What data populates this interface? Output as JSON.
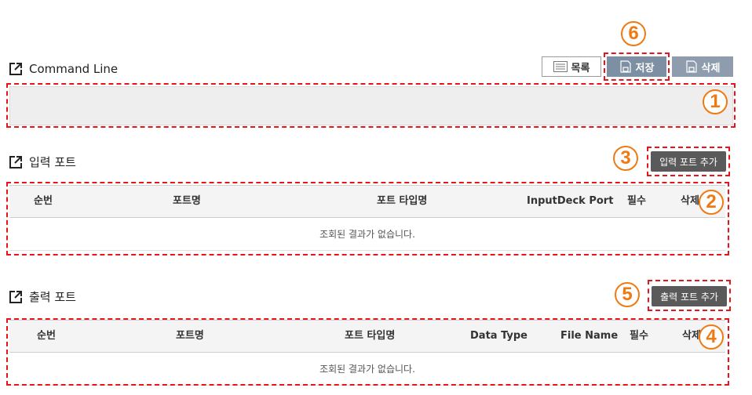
{
  "toolbar": {
    "list_label": "목록",
    "save_label": "저장",
    "delete_label": "삭제"
  },
  "command_line": {
    "title": "Command Line",
    "value": ""
  },
  "input_ports": {
    "title": "입력 포트",
    "add_button": "입력 포트 추가",
    "columns": [
      "순번",
      "포트명",
      "포트 타입명",
      "InputDeck Port",
      "필수",
      "삭제"
    ],
    "empty_message": "조회된 결과가 없습니다."
  },
  "output_ports": {
    "title": "출력 포트",
    "add_button": "출력 포트 추가",
    "columns": [
      "순번",
      "포트명",
      "포트 타입명",
      "Data Type",
      "File Name",
      "필수",
      "삭제"
    ],
    "empty_message": "조회된 결과가 없습니다."
  },
  "callouts": [
    "1",
    "2",
    "3",
    "4",
    "5",
    "6"
  ],
  "colors": {
    "callout_orange": "#f07a12",
    "dashed_red": "#e8141a",
    "button_blue_gray": "#7d8fa3",
    "button_dark": "#5a5a5a"
  }
}
